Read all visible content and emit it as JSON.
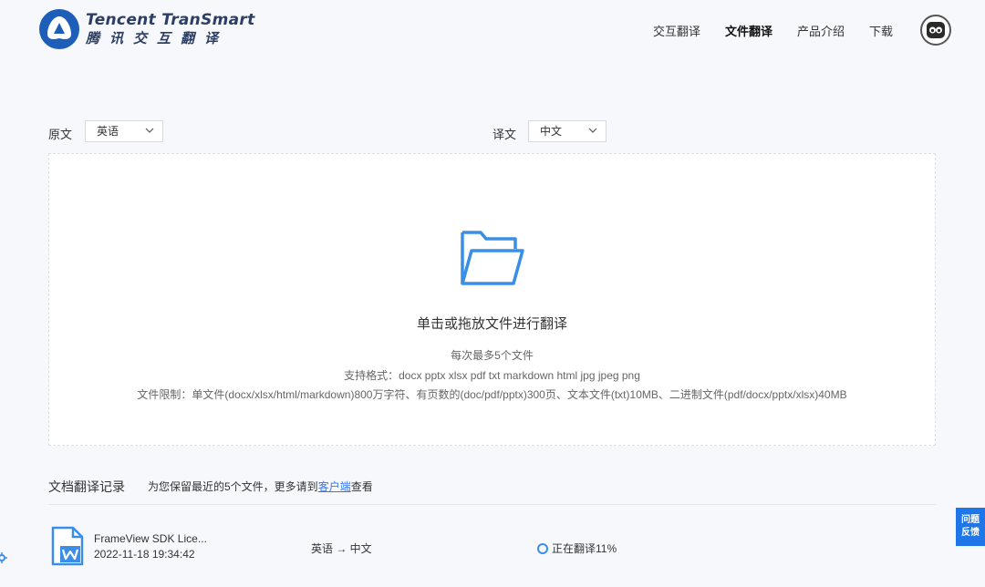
{
  "brand": {
    "name_en": "Tencent TranSmart",
    "name_cn": "腾讯交互翻译"
  },
  "nav": [
    {
      "label": "交互翻译",
      "active": false
    },
    {
      "label": "文件翻译",
      "active": true
    },
    {
      "label": "产品介绍",
      "active": false
    },
    {
      "label": "下载",
      "active": false
    }
  ],
  "source": {
    "label": "原文",
    "value": "英语"
  },
  "target": {
    "label": "译文",
    "value": "中文"
  },
  "dropzone": {
    "title": "单击或拖放文件进行翻译",
    "max_files": "每次最多5个文件",
    "formats": "支持格式：docx pptx xlsx pdf txt markdown html jpg jpeg png",
    "limits": "文件限制：单文件(docx/xlsx/html/markdown)800万字符、有页数的(doc/pdf/pptx)300页、文本文件(txt)10MB、二进制文件(pdf/docx/pptx/xlsx)40MB"
  },
  "records": {
    "title": "文档翻译记录",
    "note_prefix": "为您保留最近的5个文件，更多请到",
    "note_link": "客户端",
    "note_suffix": "查看",
    "items": [
      {
        "name": "FrameView SDK Lice...",
        "time": "2022-11-18 19:34:42",
        "lang": "英语 → 中文",
        "status": "正在翻译11%",
        "progress": 0.11
      }
    ]
  },
  "feedback": {
    "line1": "问题",
    "line2": "反馈"
  },
  "colors": {
    "accent": "#3478f6",
    "brand": "#2c3e63",
    "feedback_bg": "#1f76e8"
  }
}
